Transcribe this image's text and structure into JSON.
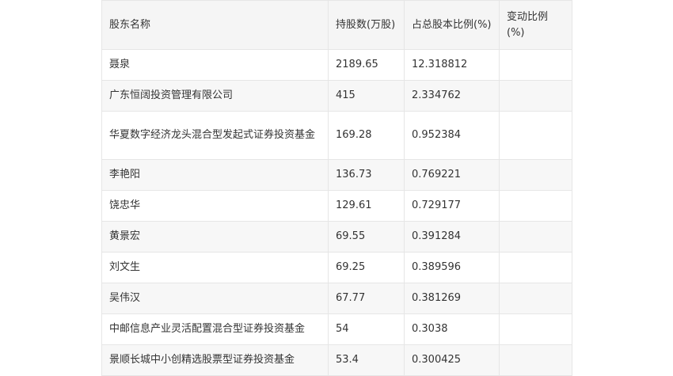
{
  "table": {
    "headers": {
      "name": "股东名称",
      "shares": "持股数(万股)",
      "percent": "占总股本比例(%)",
      "change": "变动比例(%)"
    },
    "rows": [
      {
        "name": "聂泉",
        "shares": "2189.65",
        "percent": "12.318812",
        "change": ""
      },
      {
        "name": "广东恒阔投资管理有限公司",
        "shares": "415",
        "percent": "2.334762",
        "change": ""
      },
      {
        "name": "华夏数字经济龙头混合型发起式证券投资基金",
        "shares": "169.28",
        "percent": "0.952384",
        "change": ""
      },
      {
        "name": "李艳阳",
        "shares": "136.73",
        "percent": "0.769221",
        "change": ""
      },
      {
        "name": "饶忠华",
        "shares": "129.61",
        "percent": "0.729177",
        "change": ""
      },
      {
        "name": "黄景宏",
        "shares": "69.55",
        "percent": "0.391284",
        "change": ""
      },
      {
        "name": "刘文生",
        "shares": "69.25",
        "percent": "0.389596",
        "change": ""
      },
      {
        "name": "吴伟汉",
        "shares": "67.77",
        "percent": "0.381269",
        "change": ""
      },
      {
        "name": "中邮信息产业灵活配置混合型证券投资基金",
        "shares": "54",
        "percent": "0.3038",
        "change": ""
      },
      {
        "name": "景顺长城中小创精选股票型证券投资基金",
        "shares": "53.4",
        "percent": "0.300425",
        "change": ""
      }
    ]
  }
}
